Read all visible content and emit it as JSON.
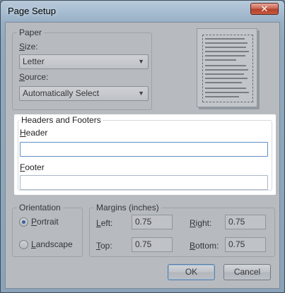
{
  "window": {
    "title": "Page Setup",
    "close_glyph": "✕"
  },
  "paper": {
    "legend": "Paper",
    "size_label": "Size:",
    "size_value": "Letter",
    "source_label": "Source:",
    "source_value": "Automatically Select"
  },
  "headers_footers": {
    "legend": "Headers and Footers",
    "header_label": "Header",
    "header_value": "",
    "footer_label": "Footer",
    "footer_value": ""
  },
  "orientation": {
    "legend": "Orientation",
    "portrait_label": "Portrait",
    "landscape_label": "Landscape",
    "selected": "Portrait"
  },
  "margins": {
    "legend": "Margins (inches)",
    "left_label": "Left:",
    "left_value": "0.75",
    "right_label": "Right:",
    "right_value": "0.75",
    "top_label": "Top:",
    "top_value": "0.75",
    "bottom_label": "Bottom:",
    "bottom_value": "0.75"
  },
  "buttons": {
    "ok": "OK",
    "cancel": "Cancel"
  },
  "colors": {
    "highlight": "#ffffff",
    "dim_overlay": "#787d82",
    "accent": "#2b5fa3"
  }
}
